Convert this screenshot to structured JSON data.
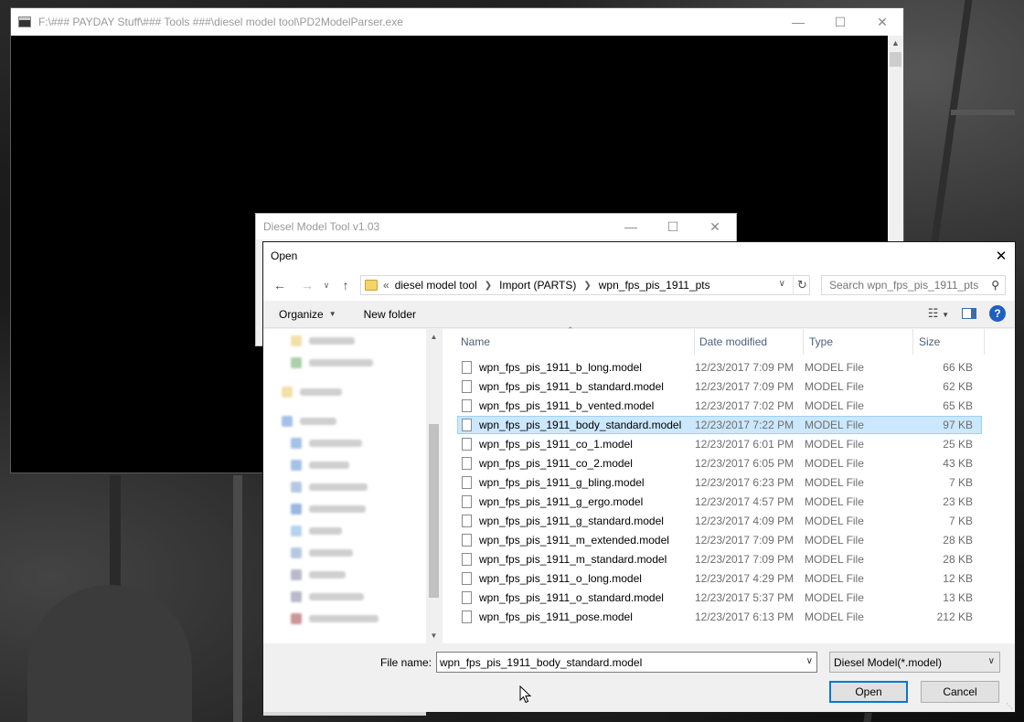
{
  "console": {
    "title": "F:\\### PAYDAY Stuff\\### Tools ###\\diesel model tool\\PD2ModelParser.exe"
  },
  "diesel_window": {
    "title": "Diesel Model Tool v1.03"
  },
  "dialog": {
    "title": "Open",
    "breadcrumb": {
      "overflow": "«",
      "items": [
        "diesel model tool",
        "Import (PARTS)",
        "wpn_fps_pis_1911_pts"
      ]
    },
    "search_placeholder": "Search wpn_fps_pis_1911_pts",
    "toolbar": {
      "organize": "Organize",
      "new_folder": "New folder",
      "help": "?"
    },
    "columns": {
      "name": "Name",
      "date_modified": "Date modified",
      "type": "Type",
      "size": "Size"
    },
    "files": [
      {
        "name": "wpn_fps_pis_1911_b_long.model",
        "date": "12/23/2017 7:09 PM",
        "type": "MODEL File",
        "size": "66 KB"
      },
      {
        "name": "wpn_fps_pis_1911_b_standard.model",
        "date": "12/23/2017 7:09 PM",
        "type": "MODEL File",
        "size": "62 KB"
      },
      {
        "name": "wpn_fps_pis_1911_b_vented.model",
        "date": "12/23/2017 7:02 PM",
        "type": "MODEL File",
        "size": "65 KB"
      },
      {
        "name": "wpn_fps_pis_1911_body_standard.model",
        "date": "12/23/2017 7:22 PM",
        "type": "MODEL File",
        "size": "97 KB"
      },
      {
        "name": "wpn_fps_pis_1911_co_1.model",
        "date": "12/23/2017 6:01 PM",
        "type": "MODEL File",
        "size": "25 KB"
      },
      {
        "name": "wpn_fps_pis_1911_co_2.model",
        "date": "12/23/2017 6:05 PM",
        "type": "MODEL File",
        "size": "43 KB"
      },
      {
        "name": "wpn_fps_pis_1911_g_bling.model",
        "date": "12/23/2017 6:23 PM",
        "type": "MODEL File",
        "size": "7 KB"
      },
      {
        "name": "wpn_fps_pis_1911_g_ergo.model",
        "date": "12/23/2017 4:57 PM",
        "type": "MODEL File",
        "size": "23 KB"
      },
      {
        "name": "wpn_fps_pis_1911_g_standard.model",
        "date": "12/23/2017 4:09 PM",
        "type": "MODEL File",
        "size": "7 KB"
      },
      {
        "name": "wpn_fps_pis_1911_m_extended.model",
        "date": "12/23/2017 7:09 PM",
        "type": "MODEL File",
        "size": "28 KB"
      },
      {
        "name": "wpn_fps_pis_1911_m_standard.model",
        "date": "12/23/2017 7:09 PM",
        "type": "MODEL File",
        "size": "28 KB"
      },
      {
        "name": "wpn_fps_pis_1911_o_long.model",
        "date": "12/23/2017 4:29 PM",
        "type": "MODEL File",
        "size": "12 KB"
      },
      {
        "name": "wpn_fps_pis_1911_o_standard.model",
        "date": "12/23/2017 5:37 PM",
        "type": "MODEL File",
        "size": "13 KB"
      },
      {
        "name": "wpn_fps_pis_1911_pose.model",
        "date": "12/23/2017 6:13 PM",
        "type": "MODEL File",
        "size": "212 KB"
      }
    ],
    "selected_index": 3,
    "file_name_label": "File name:",
    "file_name_value": "wpn_fps_pis_1911_body_standard.model",
    "filter": "Diesel Model(*.model)",
    "open_button": "Open",
    "cancel_button": "Cancel"
  },
  "colors": {
    "selection": "#cce8ff",
    "selection_border": "#99d1ff",
    "accent": "#0078d7"
  }
}
